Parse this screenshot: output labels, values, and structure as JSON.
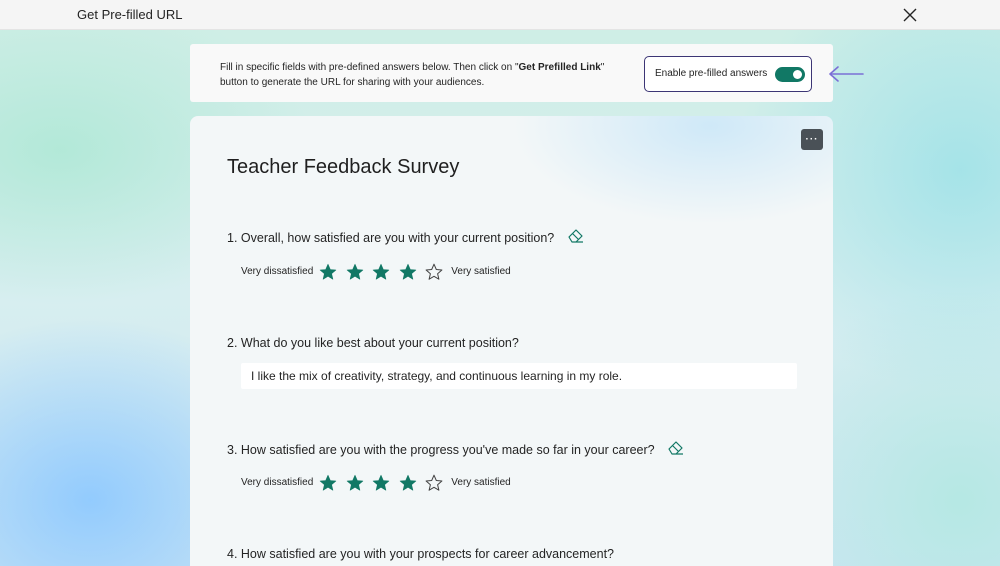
{
  "window": {
    "title": "Get Pre-filled URL",
    "close_icon": "close-icon"
  },
  "notice": {
    "text_before": "Fill in specific fields with pre-defined answers below. Then click on \"",
    "text_bold": "Get Prefilled Link",
    "text_after": "\" button to generate the URL for sharing with your audiences.",
    "toggle_label": "Enable pre-filled answers",
    "toggle_on": true,
    "toggle_color": "#117865",
    "border_color": "#3c3575",
    "arrow_color": "#7b6fd6"
  },
  "survey": {
    "title": "Teacher Feedback Survey",
    "more_label": "···",
    "questions": [
      {
        "label": "1. Overall, how satisfied are you with your current position?",
        "type": "rating",
        "low": "Very dissatisfied",
        "high": "Very satisfied",
        "value": 4,
        "max": 5
      },
      {
        "label": "2. What do you like best about your current position?",
        "type": "text",
        "answer": "I like the mix of creativity, strategy, and continuous learning in my role."
      },
      {
        "label": "3. How satisfied are you with the progress you've made so far in your career?",
        "type": "rating",
        "low": "Very dissatisfied",
        "high": "Very satisfied",
        "value": 4,
        "max": 5
      },
      {
        "label": "4. How satisfied are you with your prospects for career advancement?",
        "type": "rating"
      }
    ],
    "accent_color": "#117865"
  }
}
